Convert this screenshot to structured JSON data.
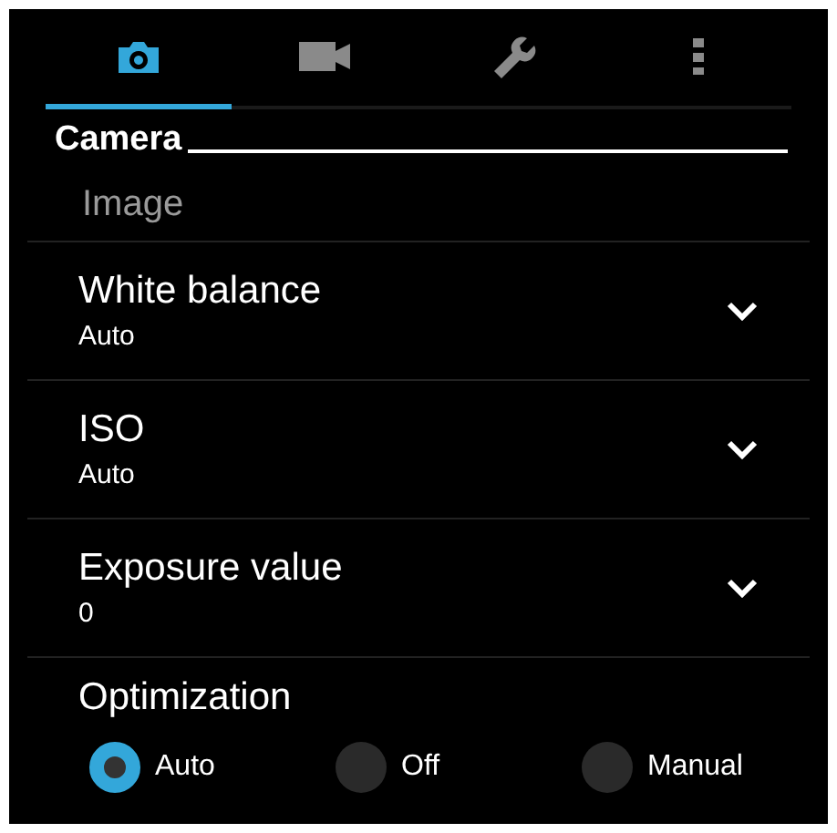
{
  "tabs": [
    {
      "kind": "camera",
      "selected": true
    },
    {
      "kind": "video",
      "selected": false
    },
    {
      "kind": "tools",
      "selected": false
    },
    {
      "kind": "more",
      "selected": false
    }
  ],
  "section_title": "Camera",
  "category": "Image",
  "settings": [
    {
      "label": "White balance",
      "value": "Auto"
    },
    {
      "label": "ISO",
      "value": "Auto"
    },
    {
      "label": "Exposure value",
      "value": "0"
    }
  ],
  "optimization": {
    "label": "Optimization",
    "options": [
      {
        "label": "Auto",
        "selected": true
      },
      {
        "label": "Off",
        "selected": false
      },
      {
        "label": "Manual",
        "selected": false
      }
    ]
  }
}
